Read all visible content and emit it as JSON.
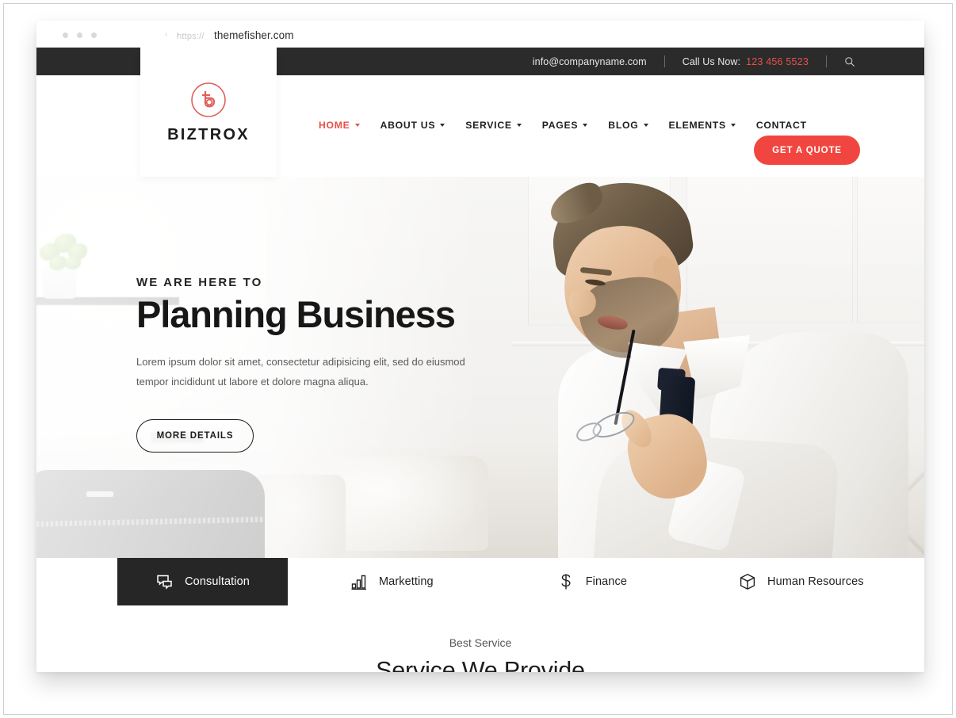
{
  "browser": {
    "url_protocol": "https://",
    "url_host": "themefisher.com",
    "back_arrow": "‹",
    "forward_arrow": "›"
  },
  "topbar": {
    "email": "info@companyname.com",
    "call_label": "Call Us Now:",
    "phone": "123 456 5523",
    "search_icon": "search-icon"
  },
  "brand": {
    "name": "BIZTROX",
    "logo_icon": "biztrox-monogram-icon",
    "accent_color": "#e8504a"
  },
  "nav": {
    "items": [
      {
        "label": "HOME",
        "has_caret": true,
        "active": true
      },
      {
        "label": "ABOUT US",
        "has_caret": true,
        "active": false
      },
      {
        "label": "SERVICE",
        "has_caret": true,
        "active": false
      },
      {
        "label": "PAGES",
        "has_caret": true,
        "active": false
      },
      {
        "label": "BLOG",
        "has_caret": true,
        "active": false
      },
      {
        "label": "ELEMENTS",
        "has_caret": true,
        "active": false
      },
      {
        "label": "CONTACT",
        "has_caret": false,
        "active": false
      }
    ],
    "cta_label": "GET A QUOTE",
    "cta_color": "#f1463f"
  },
  "hero": {
    "eyebrow": "WE ARE HERE TO",
    "title": "Planning Business",
    "subtitle": "Lorem ipsum dolor sit amet, consectetur adipisicing elit, sed do eiusmod tempor incididunt ut labore et dolore magna aliqua.",
    "button_label": "MORE DETAILS"
  },
  "tabs": [
    {
      "label": "Consultation",
      "icon": "chat-bubble-icon",
      "active": true
    },
    {
      "label": "Marketting",
      "icon": "bar-chart-icon",
      "active": false
    },
    {
      "label": "Finance",
      "icon": "dollar-sign-icon",
      "active": false
    },
    {
      "label": "Human Resources",
      "icon": "box-icon",
      "active": false
    }
  ],
  "services": {
    "kicker": "Best Service",
    "title": "Service We Provide",
    "divider_color": "#d86862"
  }
}
